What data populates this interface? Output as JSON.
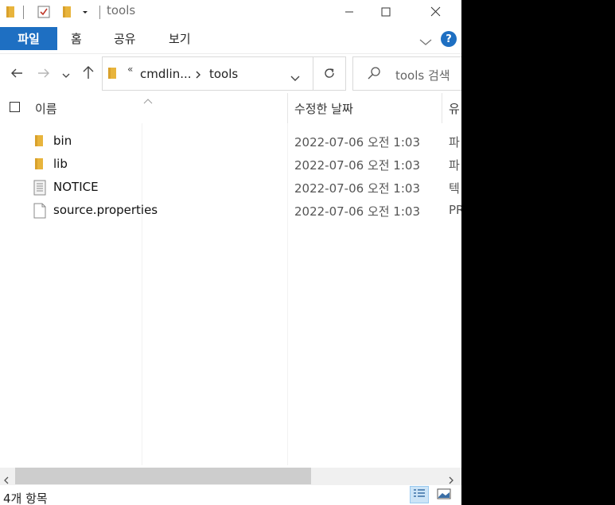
{
  "titlebar": {
    "title": "tools",
    "controls": [
      "minimize-icon",
      "maximize-icon",
      "close-icon"
    ]
  },
  "ribbon": {
    "file_tab": "파일",
    "tabs": [
      "홈",
      "공유",
      "보기"
    ],
    "help": "?"
  },
  "address": {
    "overflow": "«",
    "crumbs": [
      "cmdlin...",
      "tools"
    ]
  },
  "search": {
    "placeholder": "tools 검색"
  },
  "columns": {
    "name": "이름",
    "modified": "수정한 날짜",
    "type": "유"
  },
  "files": [
    {
      "name": "bin",
      "modified": "2022-07-06 오전 1:03",
      "type": "파",
      "icon": "folder-icon"
    },
    {
      "name": "lib",
      "modified": "2022-07-06 오전 1:03",
      "type": "파",
      "icon": "folder-icon"
    },
    {
      "name": "NOTICE",
      "modified": "2022-07-06 오전 1:03",
      "type": "텍",
      "icon": "text-file-icon"
    },
    {
      "name": "source.properties",
      "modified": "2022-07-06 오전 1:03",
      "type": "PR",
      "icon": "file-icon"
    }
  ],
  "status": {
    "count": "4개 항목"
  },
  "colors": {
    "accent": "#1e6fc2",
    "folder": "#e8b43c"
  }
}
